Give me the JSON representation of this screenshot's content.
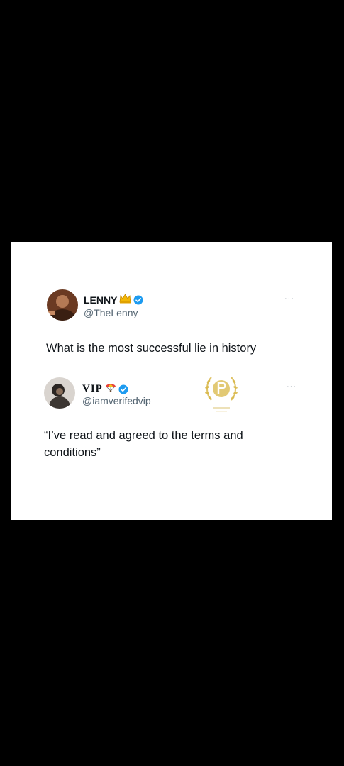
{
  "tweet1": {
    "name": "LENNY",
    "handle": "@TheLenny_",
    "text": "What is the most successful lie in history",
    "more_label": "···"
  },
  "tweet2": {
    "name": "VIP",
    "handle": "@iamverifedvip",
    "text": "“I’ve read and agreed to the terms and conditions”",
    "more_label": "···"
  },
  "colors": {
    "background": "#000000",
    "card": "#ffffff",
    "verified": "#1d9bf0",
    "text": "#0f1419",
    "secondary": "#536471",
    "watermark_gold": "#d9b84a"
  },
  "icons": {
    "tweet1_badge": "crown-icon",
    "tweet2_badge": "parachute-icon",
    "verified": "verified-check-icon"
  }
}
